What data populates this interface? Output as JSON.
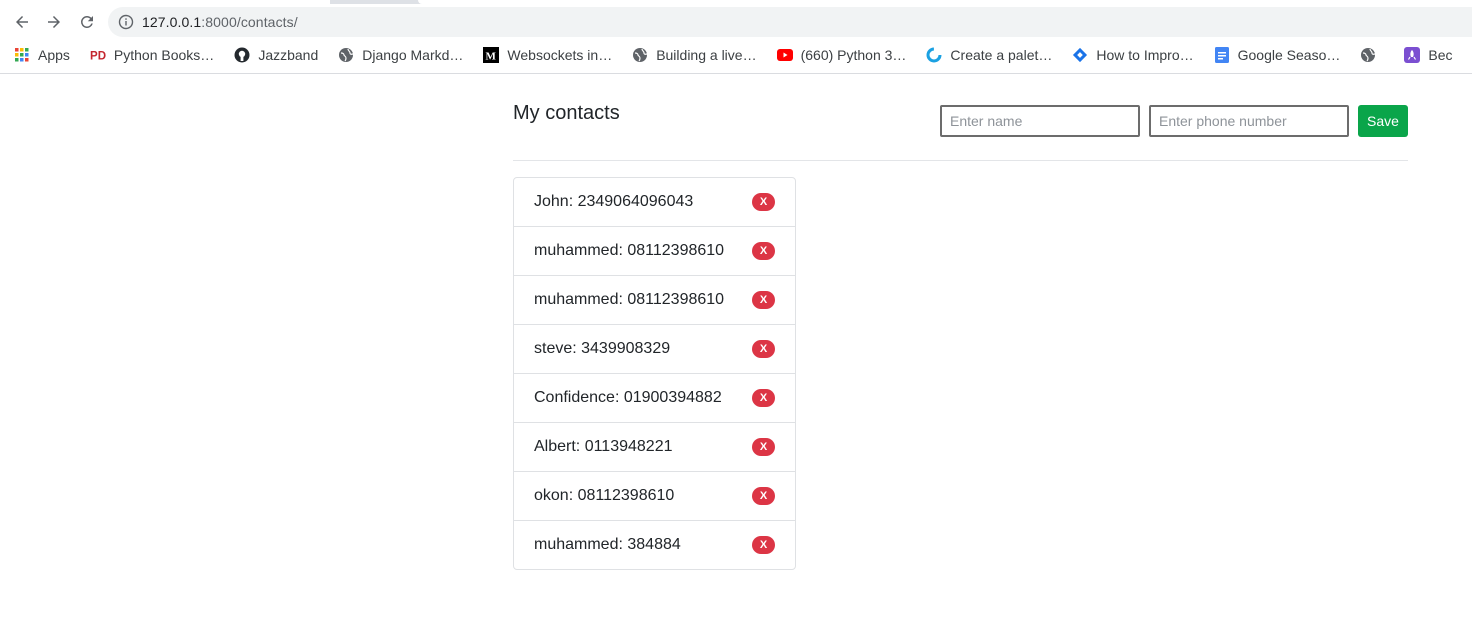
{
  "browser": {
    "url_host": "127.0.0.1",
    "url_path": ":8000/contacts/",
    "bookmarks": [
      {
        "label": "Apps",
        "icon": "apps-grid-icon"
      },
      {
        "label": "Python Books…",
        "icon": "pd-logo-icon"
      },
      {
        "label": "Jazzband",
        "icon": "github-icon"
      },
      {
        "label": "Django Markd…",
        "icon": "globe-icon"
      },
      {
        "label": "Websockets in…",
        "icon": "medium-icon"
      },
      {
        "label": "Building a live…",
        "icon": "globe-icon"
      },
      {
        "label": "(660) Python 3…",
        "icon": "youtube-icon"
      },
      {
        "label": "Create a palet…",
        "icon": "c-logo-icon"
      },
      {
        "label": "How to Impro…",
        "icon": "diamond-icon"
      },
      {
        "label": "Google Seaso…",
        "icon": "docs-icon"
      },
      {
        "label": "",
        "icon": "globe-icon"
      },
      {
        "label": "Bec",
        "icon": "rocket-icon"
      }
    ]
  },
  "page": {
    "title": "My contacts",
    "form": {
      "name_placeholder": "Enter name",
      "phone_placeholder": "Enter phone number",
      "save_label": "Save"
    },
    "delete_label": "X",
    "contacts": [
      "John: 2349064096043",
      "muhammed: 08112398610",
      "muhammed: 08112398610",
      "steve: 3439908329",
      "Confidence: 01900394882",
      "Albert: 0113948221",
      "okon: 08112398610",
      "muhammed: 384884"
    ]
  },
  "colors": {
    "save_button": "#0aa54a",
    "delete_badge": "#dc3545"
  }
}
